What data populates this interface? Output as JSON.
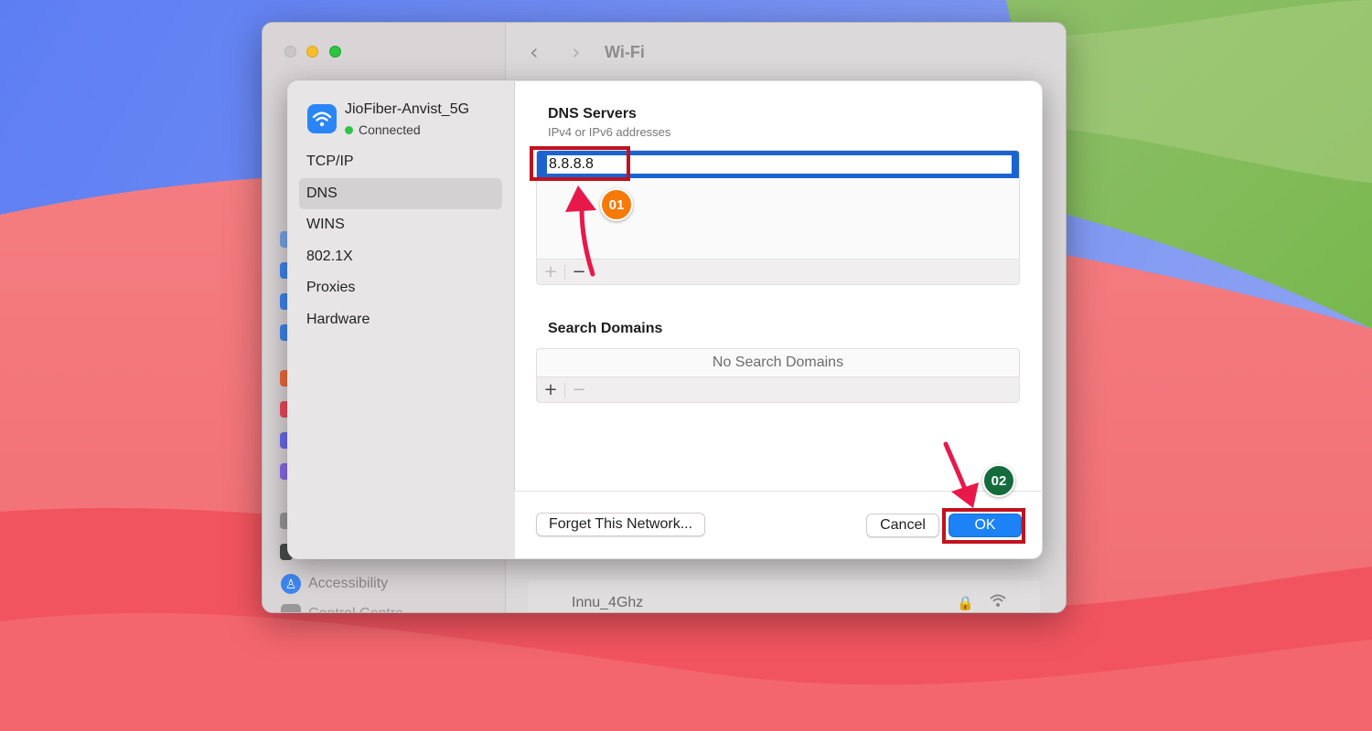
{
  "window": {
    "title": "Wi-Fi",
    "sidebar_visible_item": "Accessibility",
    "sidebar_cut_item": "Control Centre",
    "background_network": "Innu_4Ghz"
  },
  "sheet": {
    "network_name": "JioFiber-Anvist_5G",
    "network_status": "Connected",
    "menu": [
      {
        "label": "TCP/IP",
        "selected": false
      },
      {
        "label": "DNS",
        "selected": true
      },
      {
        "label": "WINS",
        "selected": false
      },
      {
        "label": "802.1X",
        "selected": false
      },
      {
        "label": "Proxies",
        "selected": false
      },
      {
        "label": "Hardware",
        "selected": false
      }
    ],
    "dns": {
      "title": "DNS Servers",
      "subtitle": "IPv4 or IPv6 addresses",
      "server_value": "8.8.8.8"
    },
    "search_domains": {
      "title": "Search Domains",
      "empty_text": "No Search Domains"
    },
    "toolbar": {
      "add": "+",
      "remove": "−"
    },
    "buttons": {
      "forget": "Forget This Network...",
      "cancel": "Cancel",
      "ok": "OK"
    }
  },
  "annotations": {
    "step1": "01",
    "step2": "02",
    "highlight_color": "#c1121f",
    "arrow_color": "#e8184a",
    "badge1_color": "#f77a09",
    "badge2_color": "#146c3c"
  }
}
